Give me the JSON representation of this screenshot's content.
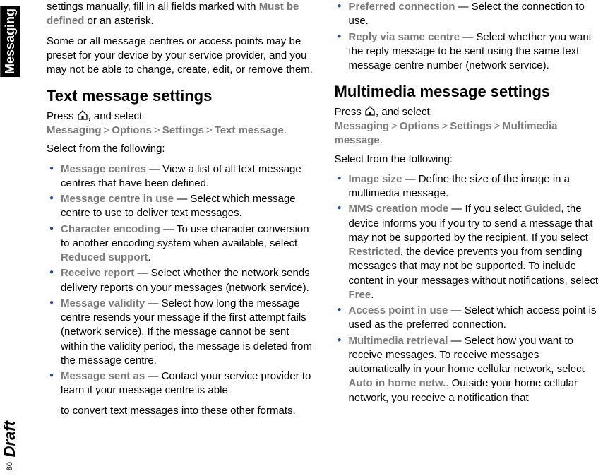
{
  "side": {
    "section_label": "Messaging",
    "draft_label": "Draft",
    "page_number": "80"
  },
  "col1": {
    "intro_frag_pre": "settings manually, fill in all fields marked with ",
    "must_be_defined": "Must be defined",
    "intro_frag_post": " or an asterisk.",
    "preset_note": "Some or all message centres or access points may be preset for your device by your service provider, and you may not be able to change, create, edit, or remove them.",
    "heading": "Text message settings",
    "press": "Press ",
    "press_post": ", and select ",
    "menu1": "Messaging",
    "menu2": "Options",
    "menu3": "Settings",
    "menu4": "Text message",
    "select_from": "Select from the following:",
    "items": [
      {
        "label": "Message centres",
        "desc": " — View a list of all text message centres that have been defined."
      },
      {
        "label": "Message centre in use",
        "desc": "  — Select which message centre to use to deliver text messages."
      },
      {
        "label": "Character encoding",
        "desc_pre": " — To use character conversion to another encoding system when available, select ",
        "opt": "Reduced support",
        "desc_post": "."
      },
      {
        "label": "Receive report",
        "desc": " — Select whether the network sends delivery reports on your messages (network service)."
      },
      {
        "label": "Message validity",
        "desc": " — Select how long the message centre resends your message if the first attempt fails (network service). If the message cannot be sent within the validity period, the message is deleted from the message centre."
      },
      {
        "label": "Message sent as",
        "desc": "  — Contact your service provider to learn if your message centre is able"
      }
    ]
  },
  "col2": {
    "cont_frag": "to convert text messages into these other formats.",
    "items_cont": [
      {
        "label": "Preferred connection",
        "desc": " — Select the connection to use."
      },
      {
        "label": "Reply via same centre",
        "desc": " — Select whether you want the reply message to be sent using the same text message centre number (network service)."
      }
    ],
    "heading": "Multimedia message settings",
    "press": "Press ",
    "press_post": ", and select ",
    "menu1": "Messaging",
    "menu2": "Options",
    "menu3": "Settings",
    "menu4": "Multimedia message",
    "select_from": "Select from the following:",
    "items": [
      {
        "label": "Image size",
        "desc": "  — Define the size of the image in a multimedia message."
      },
      {
        "label": "MMS creation mode",
        "desc_pre": "  — If you select ",
        "opt1": "Guided",
        "desc_mid1": ", the device informs you if you try to send a message that may not be supported by the recipient. If you select ",
        "opt2": "Restricted",
        "desc_mid2": ", the device prevents you from sending messages that may not be supported. To include content in your messages without notifications, select ",
        "opt3": "Free",
        "desc_post": "."
      },
      {
        "label": "Access point in use",
        "desc": "  — Select which access point is used as the preferred connection."
      },
      {
        "label": "Multimedia retrieval",
        "desc_pre": "  — Select how you want to receive messages. To receive messages automatically in your home cellular network, select ",
        "opt": "Auto in home netw.",
        "desc_post": ". Outside your home cellular network, you receive a notification that"
      }
    ]
  }
}
